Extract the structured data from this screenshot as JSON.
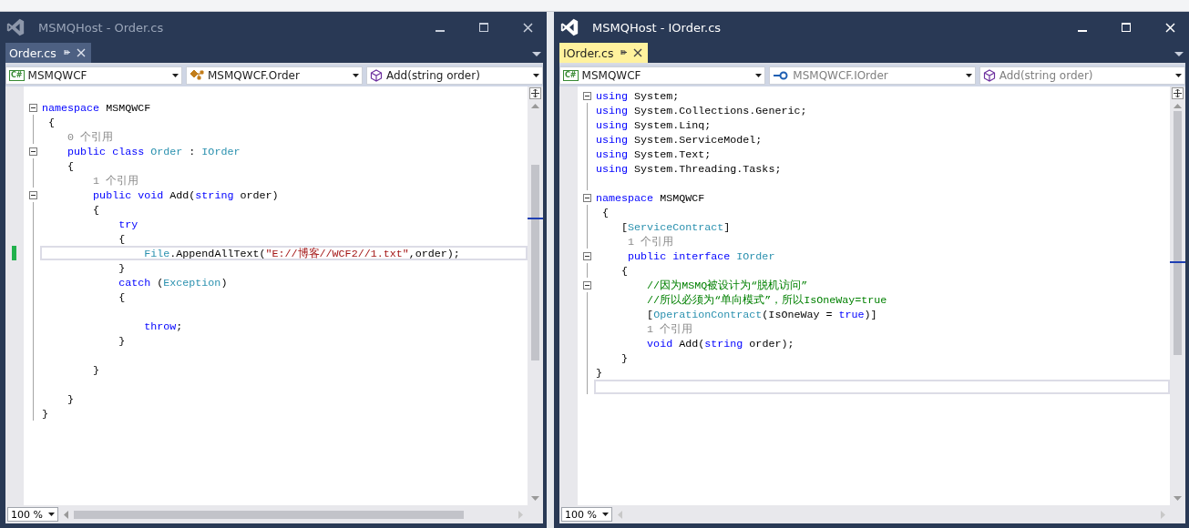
{
  "windows": [
    {
      "title": "MSMQHost - Order.cs",
      "active": false,
      "tab": {
        "label": "Order.cs"
      },
      "combos": [
        {
          "kind": "project",
          "badge": "C#",
          "text": "MSMQWCF",
          "dimmed": false
        },
        {
          "kind": "class",
          "text": "MSMQWCF.Order",
          "dimmed": false
        },
        {
          "kind": "method",
          "text": "Add(string order)",
          "dimmed": false
        }
      ],
      "lines": [
        {
          "kind": "code",
          "fold": true,
          "current": false,
          "tokens": [
            {
              "text": "namespace",
              "kind": "kw"
            },
            {
              "text": " MSMQWCF",
              "kind": "plain"
            }
          ]
        },
        {
          "kind": "code",
          "fold": false,
          "current": false,
          "tokens": [
            {
              "text": " {",
              "kind": "plain"
            }
          ]
        },
        {
          "kind": "code",
          "fold": false,
          "current": false,
          "tokens": [
            {
              "text": "    0 个引用",
              "kind": "ref"
            }
          ]
        },
        {
          "kind": "code",
          "fold": true,
          "current": false,
          "tokens": [
            {
              "text": "    public class",
              "kind": "kw"
            },
            {
              "text": " Order",
              "kind": "type"
            },
            {
              "text": " : ",
              "kind": "plain"
            },
            {
              "text": "IOrder",
              "kind": "type"
            }
          ]
        },
        {
          "kind": "code",
          "fold": false,
          "current": false,
          "tokens": [
            {
              "text": "    {",
              "kind": "plain"
            }
          ]
        },
        {
          "kind": "code",
          "fold": false,
          "current": false,
          "tokens": [
            {
              "text": "        1 个引用",
              "kind": "ref"
            }
          ]
        },
        {
          "kind": "code",
          "fold": true,
          "current": false,
          "tokens": [
            {
              "text": "        public void",
              "kind": "kw"
            },
            {
              "text": " Add(",
              "kind": "plain"
            },
            {
              "text": "string",
              "kind": "kw"
            },
            {
              "text": " order)",
              "kind": "plain"
            }
          ]
        },
        {
          "kind": "code",
          "fold": false,
          "current": false,
          "tokens": [
            {
              "text": "        {",
              "kind": "plain"
            }
          ]
        },
        {
          "kind": "code",
          "fold": false,
          "current": false,
          "tokens": [
            {
              "text": "            try",
              "kind": "kw"
            }
          ]
        },
        {
          "kind": "code",
          "fold": false,
          "current": false,
          "tokens": [
            {
              "text": "            {",
              "kind": "plain"
            }
          ]
        },
        {
          "kind": "code",
          "fold": false,
          "current": true,
          "tokens": [
            {
              "text": "                File",
              "kind": "type"
            },
            {
              "text": ".AppendAllText(",
              "kind": "plain"
            },
            {
              "text": "\"E://博客//WCF2//1.txt\"",
              "kind": "str"
            },
            {
              "text": ",order);",
              "kind": "plain"
            }
          ]
        },
        {
          "kind": "code",
          "fold": false,
          "current": false,
          "tokens": [
            {
              "text": "            }",
              "kind": "plain"
            }
          ]
        },
        {
          "kind": "code",
          "fold": false,
          "current": false,
          "tokens": [
            {
              "text": "            catch",
              "kind": "kw"
            },
            {
              "text": " (",
              "kind": "plain"
            },
            {
              "text": "Exception",
              "kind": "type"
            },
            {
              "text": ")",
              "kind": "plain"
            }
          ]
        },
        {
          "kind": "code",
          "fold": false,
          "current": false,
          "tokens": [
            {
              "text": "            {",
              "kind": "plain"
            }
          ]
        },
        {
          "kind": "blank",
          "fold": false,
          "current": false
        },
        {
          "kind": "code",
          "fold": false,
          "current": false,
          "tokens": [
            {
              "text": "                throw",
              "kind": "kw"
            },
            {
              "text": ";",
              "kind": "plain"
            }
          ]
        },
        {
          "kind": "code",
          "fold": false,
          "current": false,
          "tokens": [
            {
              "text": "            }",
              "kind": "plain"
            }
          ]
        },
        {
          "kind": "blank",
          "fold": false,
          "current": false
        },
        {
          "kind": "code",
          "fold": false,
          "current": false,
          "tokens": [
            {
              "text": "        }",
              "kind": "plain"
            }
          ]
        },
        {
          "kind": "blank",
          "fold": false,
          "current": false
        },
        {
          "kind": "code",
          "fold": false,
          "current": false,
          "tokens": [
            {
              "text": "    }",
              "kind": "plain"
            }
          ]
        },
        {
          "kind": "code",
          "fold": false,
          "current": false,
          "tokens": [
            {
              "text": "}",
              "kind": "plain"
            }
          ]
        }
      ],
      "zoom": "100 %"
    },
    {
      "title": "MSMQHost - IOrder.cs",
      "active": true,
      "tab": {
        "label": "IOrder.cs"
      },
      "combos": [
        {
          "kind": "project",
          "badge": "C#",
          "text": "MSMQWCF",
          "dimmed": false
        },
        {
          "kind": "interface",
          "text": "MSMQWCF.IOrder",
          "dimmed": true
        },
        {
          "kind": "method",
          "text": "Add(string order)",
          "dimmed": true
        }
      ],
      "lines": [
        {
          "kind": "code",
          "fold": true,
          "current": false,
          "tokens": [
            {
              "text": "using",
              "kind": "kw"
            },
            {
              "text": " System;",
              "kind": "plain"
            }
          ]
        },
        {
          "kind": "code",
          "fold": false,
          "current": false,
          "tokens": [
            {
              "text": "using",
              "kind": "kw"
            },
            {
              "text": " System.Collections.Generic;",
              "kind": "plain"
            }
          ]
        },
        {
          "kind": "code",
          "fold": false,
          "current": false,
          "tokens": [
            {
              "text": "using",
              "kind": "kw"
            },
            {
              "text": " System.Linq;",
              "kind": "plain"
            }
          ]
        },
        {
          "kind": "code",
          "fold": false,
          "current": false,
          "tokens": [
            {
              "text": "using",
              "kind": "kw"
            },
            {
              "text": " System.ServiceModel;",
              "kind": "plain"
            }
          ]
        },
        {
          "kind": "code",
          "fold": false,
          "current": false,
          "tokens": [
            {
              "text": "using",
              "kind": "kw"
            },
            {
              "text": " System.Text;",
              "kind": "plain"
            }
          ]
        },
        {
          "kind": "code",
          "fold": false,
          "current": false,
          "tokens": [
            {
              "text": "using",
              "kind": "kw"
            },
            {
              "text": " System.Threading.Tasks;",
              "kind": "plain"
            }
          ]
        },
        {
          "kind": "blank",
          "fold": false,
          "current": false
        },
        {
          "kind": "code",
          "fold": true,
          "current": false,
          "tokens": [
            {
              "text": "namespace",
              "kind": "kw"
            },
            {
              "text": " MSMQWCF",
              "kind": "plain"
            }
          ]
        },
        {
          "kind": "code",
          "fold": false,
          "current": false,
          "tokens": [
            {
              "text": " {",
              "kind": "plain"
            }
          ]
        },
        {
          "kind": "code",
          "fold": false,
          "current": false,
          "tokens": [
            {
              "text": "    [",
              "kind": "plain"
            },
            {
              "text": "ServiceContract",
              "kind": "type"
            },
            {
              "text": "]",
              "kind": "plain"
            }
          ]
        },
        {
          "kind": "code",
          "fold": false,
          "current": false,
          "tokens": [
            {
              "text": "     1 个引用",
              "kind": "ref"
            }
          ]
        },
        {
          "kind": "code",
          "fold": true,
          "current": false,
          "tokens": [
            {
              "text": "     public interface",
              "kind": "kw"
            },
            {
              "text": " IOrder",
              "kind": "type"
            }
          ]
        },
        {
          "kind": "code",
          "fold": false,
          "current": false,
          "tokens": [
            {
              "text": "    {",
              "kind": "plain"
            }
          ]
        },
        {
          "kind": "code",
          "fold": true,
          "current": false,
          "tokens": [
            {
              "text": "        //因为MSMQ被设计为“脱机访问”",
              "kind": "comment"
            }
          ]
        },
        {
          "kind": "code",
          "fold": false,
          "current": false,
          "tokens": [
            {
              "text": "        //所以必须为“单向模式”，所以IsOneWay=true",
              "kind": "comment"
            }
          ]
        },
        {
          "kind": "code",
          "fold": false,
          "current": false,
          "tokens": [
            {
              "text": "        [",
              "kind": "plain"
            },
            {
              "text": "OperationContract",
              "kind": "type"
            },
            {
              "text": "(IsOneWay = ",
              "kind": "plain"
            },
            {
              "text": "true",
              "kind": "kw"
            },
            {
              "text": ")]",
              "kind": "plain"
            }
          ]
        },
        {
          "kind": "code",
          "fold": false,
          "current": false,
          "tokens": [
            {
              "text": "        1 个引用",
              "kind": "ref"
            }
          ]
        },
        {
          "kind": "code",
          "fold": false,
          "current": false,
          "tokens": [
            {
              "text": "        void",
              "kind": "kw"
            },
            {
              "text": " Add(",
              "kind": "plain"
            },
            {
              "text": "string",
              "kind": "kw"
            },
            {
              "text": " order);",
              "kind": "plain"
            }
          ]
        },
        {
          "kind": "code",
          "fold": false,
          "current": false,
          "tokens": [
            {
              "text": "    }",
              "kind": "plain"
            }
          ]
        },
        {
          "kind": "code",
          "fold": false,
          "current": false,
          "tokens": [
            {
              "text": "}",
              "kind": "plain"
            }
          ]
        },
        {
          "kind": "blank",
          "fold": false,
          "current": true
        }
      ],
      "zoom": "100 %"
    }
  ]
}
